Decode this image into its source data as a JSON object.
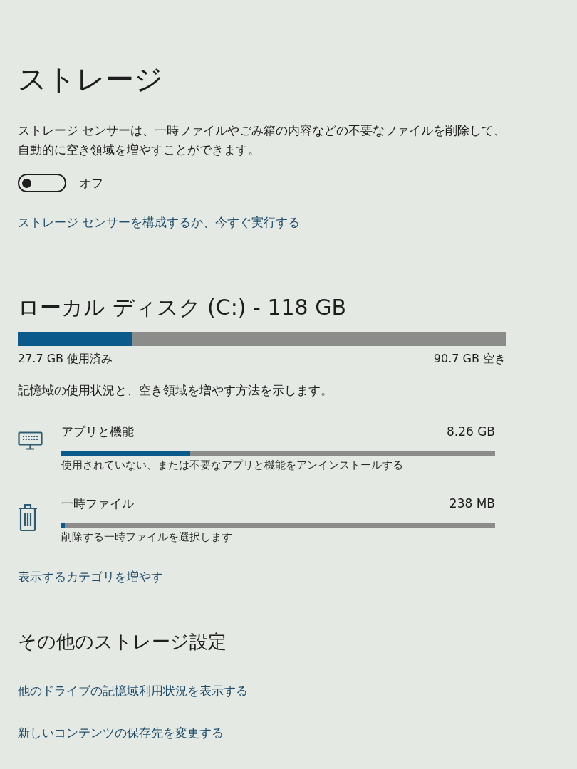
{
  "page": {
    "title": "ストレージ"
  },
  "storage_sense": {
    "description": "ストレージ センサーは、一時ファイルやごみ箱の内容などの不要なファイルを削除して、自動的に空き領域を増やすことができます。",
    "toggle": {
      "on": false,
      "label": "オフ"
    },
    "link": "ストレージ センサーを構成するか、今すぐ実行する"
  },
  "disk": {
    "title": "ローカル ディスク (C:) - 118 GB",
    "usage": {
      "level": 0.235
    },
    "used": "27.7 GB 使用済み",
    "free": "90.7 GB 空き",
    "description": "記憶域の使用状況と、空き領域を増やす方法を示します。",
    "categories": [
      {
        "kind": "apps",
        "name": "アプリと機能",
        "size": "8.26 GB",
        "level": 0.298,
        "hint": "使用されていない、または不要なアプリと機能をアンインストールする"
      },
      {
        "kind": "temp",
        "name": "一時ファイル",
        "size": "238 MB",
        "level": 0.009,
        "hint": "削除する一時ファイルを選択します"
      }
    ],
    "more_link": "表示するカテゴリを増やす"
  },
  "more_settings": {
    "title": "その他のストレージ設定",
    "links": [
      "他のドライブの記憶域利用状況を表示する",
      "新しいコンテンツの保存先を変更する"
    ]
  }
}
